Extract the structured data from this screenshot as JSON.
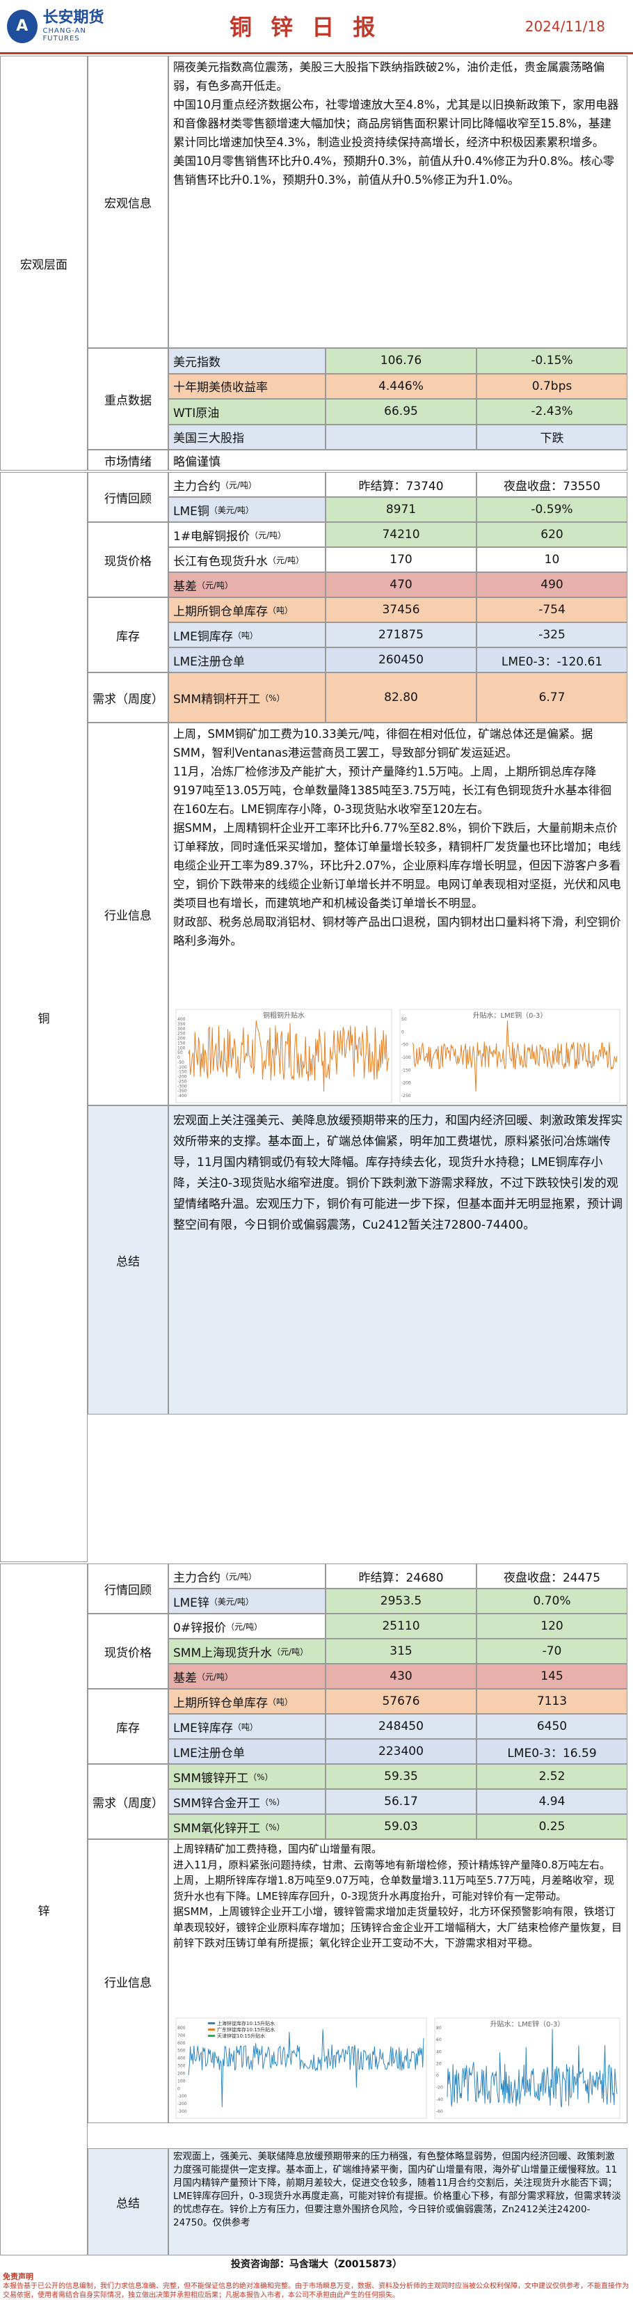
{
  "header": {
    "logo_cn": "长安期货",
    "logo_en": "CHANG-AN FUTURES",
    "title": "铜 锌 日 报",
    "date": "2024/11/18"
  },
  "macro": {
    "section": "宏观层面",
    "info_label": "宏观信息",
    "info_text": "隔夜美元指数高位震荡，美股三大股指下跌纳指跌破2%，油价走低，贵金属震荡略偏弱，有色多高开低走。\n中国10月重点经济数据公布，社零增速放大至4.8%，尤其是以旧换新政策下，家用电器和音像器材类零售额增速大幅加快；商品房销售面积累计同比降幅收窄至15.8%，基建累计同比增速加快至4.3%，制造业投资持续保持高增长，经济中积极因素累积增多。\n美国10月零售销售环比升0.4%，预期升0.3%，前值从升0.4%修正为升0.8%。核心零售销售环比升0.1%，预期升0.3%，前值从升0.5%修正为升1.0%。",
    "key_label": "重点数据",
    "rows": [
      {
        "name": "美元指数",
        "v1": "106.76",
        "v2": "-0.15%"
      },
      {
        "name": "十年期美债收益率",
        "v1": "4.446%",
        "v2": "0.7bps"
      },
      {
        "name": "WTI原油",
        "v1": "66.95",
        "v2": "-2.43%"
      },
      {
        "name": "美国三大股指",
        "v1": "",
        "v2": "下跌"
      }
    ],
    "mood_label": "市场情绪",
    "mood_value": "略偏谨慎"
  },
  "copper": {
    "section": "铜",
    "market_label": "行情回顾",
    "main_name": "主力合约",
    "main_unit": "（元/吨）",
    "main_v1": "昨结算：73740",
    "main_v2": "夜盘收盘：73550",
    "lme_name": "LME铜",
    "lme_unit": "（美元/吨）",
    "lme_v1": "8971",
    "lme_v2": "-0.59%",
    "spot_label": "现货价格",
    "spot1_name": "1#电解铜报价",
    "spot1_unit": "（元/吨）",
    "spot1_v1": "74210",
    "spot1_v2": "620",
    "spot2_name": "长江有色现货升水",
    "spot2_unit": "（元/吨）",
    "spot2_v1": "170",
    "spot2_v2": "10",
    "basis_name": "基差",
    "basis_unit": "（元/吨）",
    "basis_v1": "470",
    "basis_v2": "490",
    "stock_label": "库存",
    "st1_name": "上期所铜仓单库存",
    "st1_unit": "（吨）",
    "st1_v1": "37456",
    "st1_v2": "-754",
    "st2_name": "LME铜库存",
    "st2_unit": "（吨）",
    "st2_v1": "271875",
    "st2_v2": "-325",
    "st3_name": "LME注册仓单",
    "st3_v1": "260450",
    "st3_v2": "LME0-3：-120.61",
    "demand_label": "需求（周度）",
    "dm1_name": "SMM精铜杆开工",
    "dm1_unit": "（%）",
    "dm1_v1": "82.80",
    "dm1_v2": "6.77",
    "industry_label": "行业信息",
    "industry_text": "上周，SMM铜矿加工费为10.33美元/吨，徘徊在相对低位，矿端总体还是偏紧。据SMM，智利Ventanas港运营商员工罢工，导致部分铜矿发运延迟。\n11月，冶炼厂检修涉及产能扩大，预计产量降约1.5万吨。上周，上期所铜总库存降9197吨至13.05万吨，仓单数量降1385吨至3.75万吨，长江有色铜现货升水基本徘徊在160左右。LME铜库存小降，0-3现货贴水收窄至120左右。\n据SMM，上周精铜杆企业开工率环比升6.77%至82.8%，铜价下跌后，大量前期未点价订单释放，同时逢低采买增加，整体订单量增长较多，精铜杆厂发货量也环比增加；电线电缆企业开工率为89.37%，环比升2.07%，企业原料库存增长明显，但因下游客户多看空，铜价下跌带来的线缆企业新订单增长并不明显。电网订单表现相对坚挺，光伏和风电类项目也有增长，而建筑地产和机械设备类订单增长不明显。\n财政部、税务总局取消铝材、铜材等产品出口退税，国内铜材出口量料将下滑，利空铜价略利多海外。",
    "chart1_title": "铜粗铜升贴水",
    "chart2_title": "升贴水：LME铜（0-3）",
    "summary_label": "总结",
    "summary_text": "宏观面上关注强美元、美降息放缓预期带来的压力，和国内经济回暖、刺激政策发挥实效所带来的支撑。基本面上，矿端总体偏紧，明年加工费堪忧，原料紧张问冶炼端传导，11月国内精铜或仍有较大降幅。库存持续去化，现货升水持稳；LME铜库存小降，关注0-3现货贴水缩窄进度。铜价下跌刺激下游需求释放，不过下跌较快引发的观望情绪略升温。宏观压力下，铜价有可能进一步下探，但基本面并无明显拖累，预计调整空间有限，今日铜价或偏弱震荡，Cu2412暂关注72800-74400。",
    "chart1_y": [
      400,
      350,
      300,
      250,
      200,
      150,
      100,
      50,
      0,
      -50,
      -100,
      -150,
      -200,
      -250,
      -300,
      -350,
      -400
    ],
    "chart1_x": [
      "2024-01-02",
      "2024-02-02",
      "2024-03-02",
      "2024-04-02",
      "2024-05-02",
      "2024-06-02",
      "2024-07-02",
      "2024-08-02",
      "2024-09-02",
      "2024-10-02",
      "2024-11-02"
    ],
    "chart2_y": [
      50,
      0,
      -50,
      -100,
      -150,
      -200,
      -250
    ],
    "chart2_x": [
      "2023/11/01",
      "2024/01/01",
      "2024/03/01",
      "2024/05/01",
      "2024/07/01",
      "2024/09/01",
      "2024/11/01"
    ]
  },
  "zinc": {
    "section": "锌",
    "market_label": "行情回顾",
    "main_name": "主力合约",
    "main_unit": "（元/吨）",
    "main_v1": "昨结算：24680",
    "main_v2": "夜盘收盘：24475",
    "lme_name": "LME锌",
    "lme_unit": "（美元/吨）",
    "lme_v1": "2953.5",
    "lme_v2": "0.70%",
    "spot_label": "现货价格",
    "spot1_name": "0#锌报价",
    "spot1_unit": "（元/吨）",
    "spot1_v1": "25110",
    "spot1_v2": "120",
    "spot2_name": "SMM上海现货升水",
    "spot2_unit": "（元/吨）",
    "spot2_v1": "315",
    "spot2_v2": "-70",
    "basis_name": "基差",
    "basis_unit": "（元/吨）",
    "basis_v1": "430",
    "basis_v2": "145",
    "stock_label": "库存",
    "st1_name": "上期所锌仓单库存",
    "st1_unit": "（吨）",
    "st1_v1": "57676",
    "st1_v2": "7113",
    "st2_name": "LME锌库存",
    "st2_unit": "（吨）",
    "st2_v1": "248450",
    "st2_v2": "6450",
    "st3_name": "LME注册仓单",
    "st3_v1": "223400",
    "st3_v2": "LME0-3：16.59",
    "demand_label": "需求（周度）",
    "dm1_name": "SMM镀锌开工",
    "dm1_unit": "（%）",
    "dm1_v1": "59.35",
    "dm1_v2": "2.52",
    "dm2_name": "SMM锌合金开工",
    "dm2_unit": "（%）",
    "dm2_v1": "56.17",
    "dm2_v2": "4.94",
    "dm3_name": "SMM氧化锌开工",
    "dm3_unit": "（%）",
    "dm3_v1": "59.03",
    "dm3_v2": "0.25",
    "industry_label": "行业信息",
    "industry_text": "上周锌精矿加工费持稳，国内矿山增量有限。\n进入11月，原料紧张问题持续，甘肃、云南等地有新增检修，预计精炼锌产量降0.8万吨左右。\n上周，上期所锌库存增1.8万吨至9.07万吨，仓单数量增3.11万吨至5.77万吨，月差略收窄，现货升水也有下降。LME锌库存回升，0-3现货升水再度抬升，可能对锌价有一定带动。\n据SMM，上周镀锌企业开工小增，镀锌管需求增加走货量较好，北方环保预警影响有限，铁塔订单表现较好，镀锌企业原料库存增加；压铸锌合金企业开工增幅稍大，大厂结束检修产量恢复，目前锌下跌对压铸订单有所提振；氧化锌企业开工变动不大，下游需求相对平稳。",
    "chart1_legend": [
      "上海锌锭库存10:15升贴水",
      "广东锌锭库存10:15升贴水",
      "天津锌锭10:15升贴水"
    ],
    "chart2_title": "升贴水：LME锌（0-3）",
    "summary_label": "总结",
    "summary_text": "宏观面上，强美元、美联储降息放缓预期带来的压力稍强，有色整体略显弱势，但国内经济回暖、政策刺激力度强可能提供一定支撑。基本面上，矿端维持紧平衡，国内矿山增量有限，海外矿山增量正缓慢释放。11月国内精锌产量预计下降，前期月差较大，促进交仓较多，随着11月合约交割后，关注现货升水能否下调；LME锌库存回升，0-3现货升水再度走高，可能对锌价有提振。价格重心下移，有部分需求释放，但需求转淡的忧虑存在。锌价上方有压力，但要注意外围挤仓风险，今日锌价或偏弱震荡，Zn2412关注24200-24750。仅供参考",
    "chart1_y": [
      800,
      700,
      600,
      500,
      400,
      300,
      200,
      100,
      0,
      -100,
      -200,
      -300
    ],
    "chart2_y": [
      80,
      60,
      40,
      20,
      0,
      -20,
      -40,
      -60
    ]
  },
  "footer": {
    "researcher": "投资咨询部：马含瑞大（Z0015873）",
    "disclaimer_title": "免责声明",
    "disclaimer": "本报告基于已公开的信息编制，我们力求信息准确、完整，但不能保证信息的绝对准确和完整。由于市场瞬息万变，数据、资料及分析师的主观同时应当被公众权利保障，文中建议仅供参考，不能直接作为交易依据，使用者需结合自身实际情况，独立做出决策并承担相应后果；凡据本报告入市者，本公司不承担由此产生的任何损失。"
  }
}
